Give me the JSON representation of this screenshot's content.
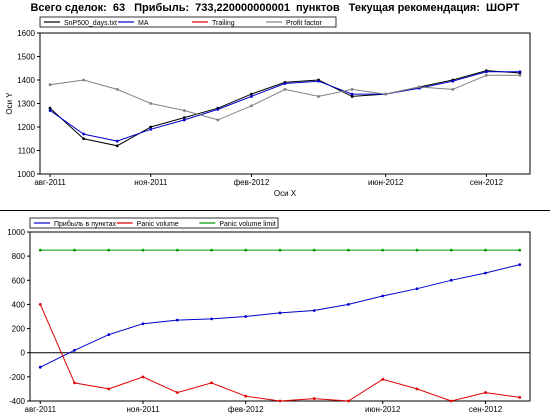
{
  "header": {
    "deals_label": "Всего сделок:",
    "deals_value": "63",
    "profit_label": "Прибыль:",
    "profit_value": "733,220000000001",
    "points_label": "пунктов",
    "rec_label": "Текущая рекомендация:",
    "rec_value": "ШОРТ"
  },
  "chart_data": [
    {
      "type": "line",
      "title": "",
      "xlabel": "Оси X",
      "ylabel": "Оси Y",
      "ylim": [
        1000,
        1600
      ],
      "yticks": [
        "1000",
        "1100",
        "1200",
        "1300",
        "1400",
        "1500",
        "1600"
      ],
      "xticks": [
        "авг-2011",
        "ноя-2011",
        "фев-2012",
        "июн-2012",
        "сен-2012"
      ],
      "x": [
        "авг-2011",
        "сен-2011",
        "окт-2011",
        "ноя-2011",
        "дек-2011",
        "янв-2012",
        "фев-2012",
        "мар-2012",
        "апр-2012",
        "май-2012",
        "июн-2012",
        "июл-2012",
        "авг-2012",
        "сен-2012",
        "окт-2012"
      ],
      "legend": [
        "SnP500_days.txt",
        "MA",
        "Trailing",
        "Profit factor"
      ],
      "legend_position": "top-left",
      "series": [
        {
          "name": "SnP500_days.txt",
          "color": "#000000",
          "values": [
            1280,
            1150,
            1120,
            1200,
            1240,
            1280,
            1340,
            1390,
            1400,
            1330,
            1340,
            1370,
            1400,
            1440,
            1430
          ]
        },
        {
          "name": "MA",
          "color": "#0000cc",
          "values": [
            1270,
            1170,
            1140,
            1190,
            1230,
            1275,
            1330,
            1385,
            1395,
            1340,
            1340,
            1365,
            1395,
            1435,
            1435
          ]
        },
        {
          "name": "Profit factor",
          "color": "#808080",
          "values": [
            1380,
            1400,
            1360,
            1300,
            1270,
            1230,
            1290,
            1360,
            1330,
            1360,
            1340,
            1370,
            1360,
            1420,
            1420
          ]
        }
      ]
    },
    {
      "type": "line",
      "title": "",
      "xlabel": "",
      "ylabel": "",
      "ylim": [
        -400,
        1000
      ],
      "yticks": [
        "-400",
        "-200",
        "0",
        "200",
        "400",
        "600",
        "800",
        "1000"
      ],
      "xticks": [
        "авг-2011",
        "ноя-2011",
        "фев-2012",
        "июн-2012",
        "сен-2012"
      ],
      "x": [
        "авг-2011",
        "сен-2011",
        "окт-2011",
        "ноя-2011",
        "дек-2011",
        "янв-2012",
        "фев-2012",
        "мар-2012",
        "апр-2012",
        "май-2012",
        "июн-2012",
        "июл-2012",
        "авг-2012",
        "сен-2012",
        "окт-2012"
      ],
      "legend": [
        "Прибыль в пунктах",
        "Panic volume",
        "Panic volume limit"
      ],
      "legend_position": "top-left",
      "series": [
        {
          "name": "Прибыль в пунктах",
          "color": "#0000cc",
          "values": [
            -120,
            20,
            150,
            240,
            270,
            280,
            300,
            330,
            350,
            400,
            470,
            530,
            600,
            660,
            730
          ]
        },
        {
          "name": "Panic volume",
          "color": "#dd0000",
          "values": [
            400,
            -250,
            -300,
            -200,
            -330,
            -250,
            -360,
            -400,
            -380,
            -400,
            -220,
            -300,
            -400,
            -330,
            -370
          ]
        },
        {
          "name": "Panic volume limit",
          "color": "#009900",
          "values": [
            850,
            850,
            850,
            850,
            850,
            850,
            850,
            850,
            850,
            850,
            850,
            850,
            850,
            850,
            850
          ]
        }
      ]
    }
  ]
}
